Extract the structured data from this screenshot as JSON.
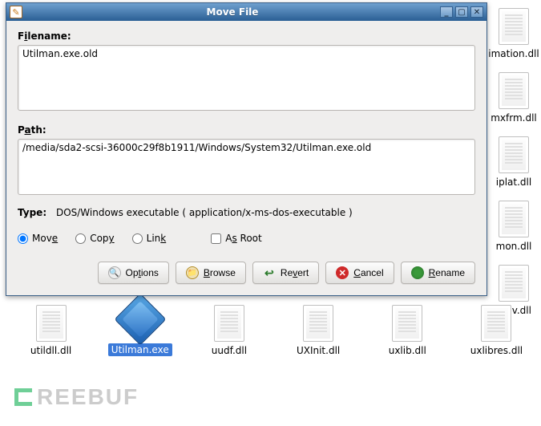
{
  "window": {
    "title": "Move File",
    "filename_label_pre": "F",
    "filename_label_u": "i",
    "filename_label_post": "lename:",
    "filename_value": "Utilman.exe.old",
    "path_label_pre": "P",
    "path_label_u": "a",
    "path_label_post": "th:",
    "path_value": "/media/sda2-scsi-36000c29f8b1911/Windows/System32/Utilman.exe.old",
    "type_label": "Type:",
    "type_value": "DOS/Windows executable ( application/x-ms-dos-executable )",
    "radios": {
      "move_pre": "Mov",
      "move_u": "e",
      "copy_pre": "Cop",
      "copy_u": "y",
      "link_pre": "Lin",
      "link_u": "k",
      "asroot_pre": "A",
      "asroot_u": "s",
      "asroot_post": " Root",
      "selected": "move",
      "as_root_checked": false
    },
    "buttons": {
      "options_pre": "Op",
      "options_u": "t",
      "options_post": "ions",
      "browse_u": "B",
      "browse_post": "rowse",
      "revert_pre": "Re",
      "revert_u": "v",
      "revert_post": "ert",
      "cancel_u": "C",
      "cancel_post": "ancel",
      "rename_u": "R",
      "rename_post": "ename"
    }
  },
  "files_row1": [
    {
      "name": "imation.dll"
    },
    {
      "name": "mxfrm.dll"
    },
    {
      "name": "iplat.dll"
    },
    {
      "name": "mon.dll"
    },
    {
      "name": "renv.dll"
    }
  ],
  "files_row2": [
    {
      "name": "utildll.dll",
      "type": "dll"
    },
    {
      "name": "Utilman.exe",
      "type": "exe",
      "selected": true
    },
    {
      "name": "uudf.dll",
      "type": "dll"
    },
    {
      "name": "UXInit.dll",
      "type": "dll"
    },
    {
      "name": "uxlib.dll",
      "type": "dll"
    },
    {
      "name": "uxlibres.dll",
      "type": "dll"
    }
  ],
  "watermark": "REEBUF"
}
